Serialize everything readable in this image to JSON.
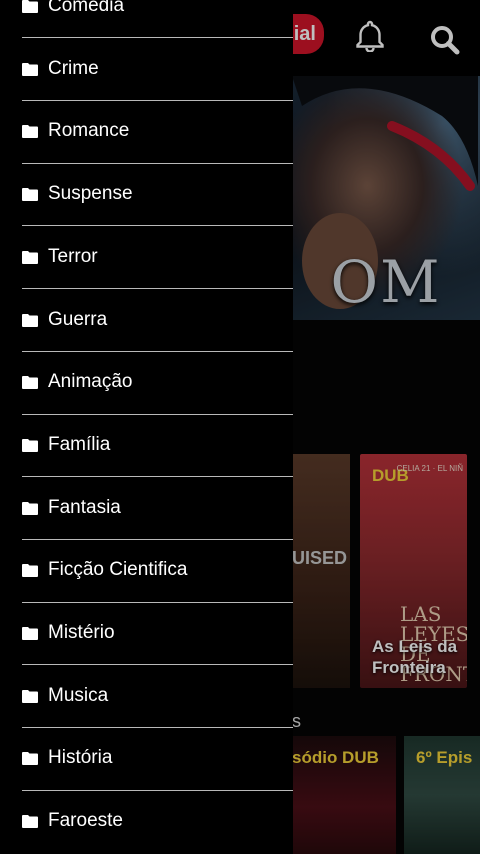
{
  "app": {
    "brand_badge": "ial",
    "hero_title": "OM",
    "poster_left_text": "UISED",
    "poster_right": {
      "badge": "DUB",
      "credit": "CELIA 21 · EL NIÑ",
      "big_title": "LAS LEYES DE FRONTE",
      "title": "As Leis da Fronteira"
    },
    "section_label": "s",
    "episodes": [
      {
        "label": "sódio DUB"
      },
      {
        "label": "6º Epis"
      }
    ]
  },
  "drawer": {
    "items": [
      {
        "label": "Comédia",
        "icon": "folder-icon"
      },
      {
        "label": "Crime",
        "icon": "folder-icon"
      },
      {
        "label": "Romance",
        "icon": "folder-icon"
      },
      {
        "label": "Suspense",
        "icon": "folder-icon"
      },
      {
        "label": "Terror",
        "icon": "folder-icon"
      },
      {
        "label": "Guerra",
        "icon": "folder-icon"
      },
      {
        "label": "Animação",
        "icon": "folder-icon"
      },
      {
        "label": "Família",
        "icon": "folder-icon"
      },
      {
        "label": "Fantasia",
        "icon": "folder-icon"
      },
      {
        "label": "Ficção Cientifica",
        "icon": "folder-icon"
      },
      {
        "label": "Mistério",
        "icon": "folder-icon"
      },
      {
        "label": "Musica",
        "icon": "folder-icon"
      },
      {
        "label": "História",
        "icon": "folder-icon"
      },
      {
        "label": "Faroeste",
        "icon": "folder-icon"
      }
    ]
  },
  "colors": {
    "accent_red": "#d0152a",
    "badge_yellow": "#f3d23a",
    "drawer_bg": "#000000",
    "divider": "#b9b9b9"
  }
}
